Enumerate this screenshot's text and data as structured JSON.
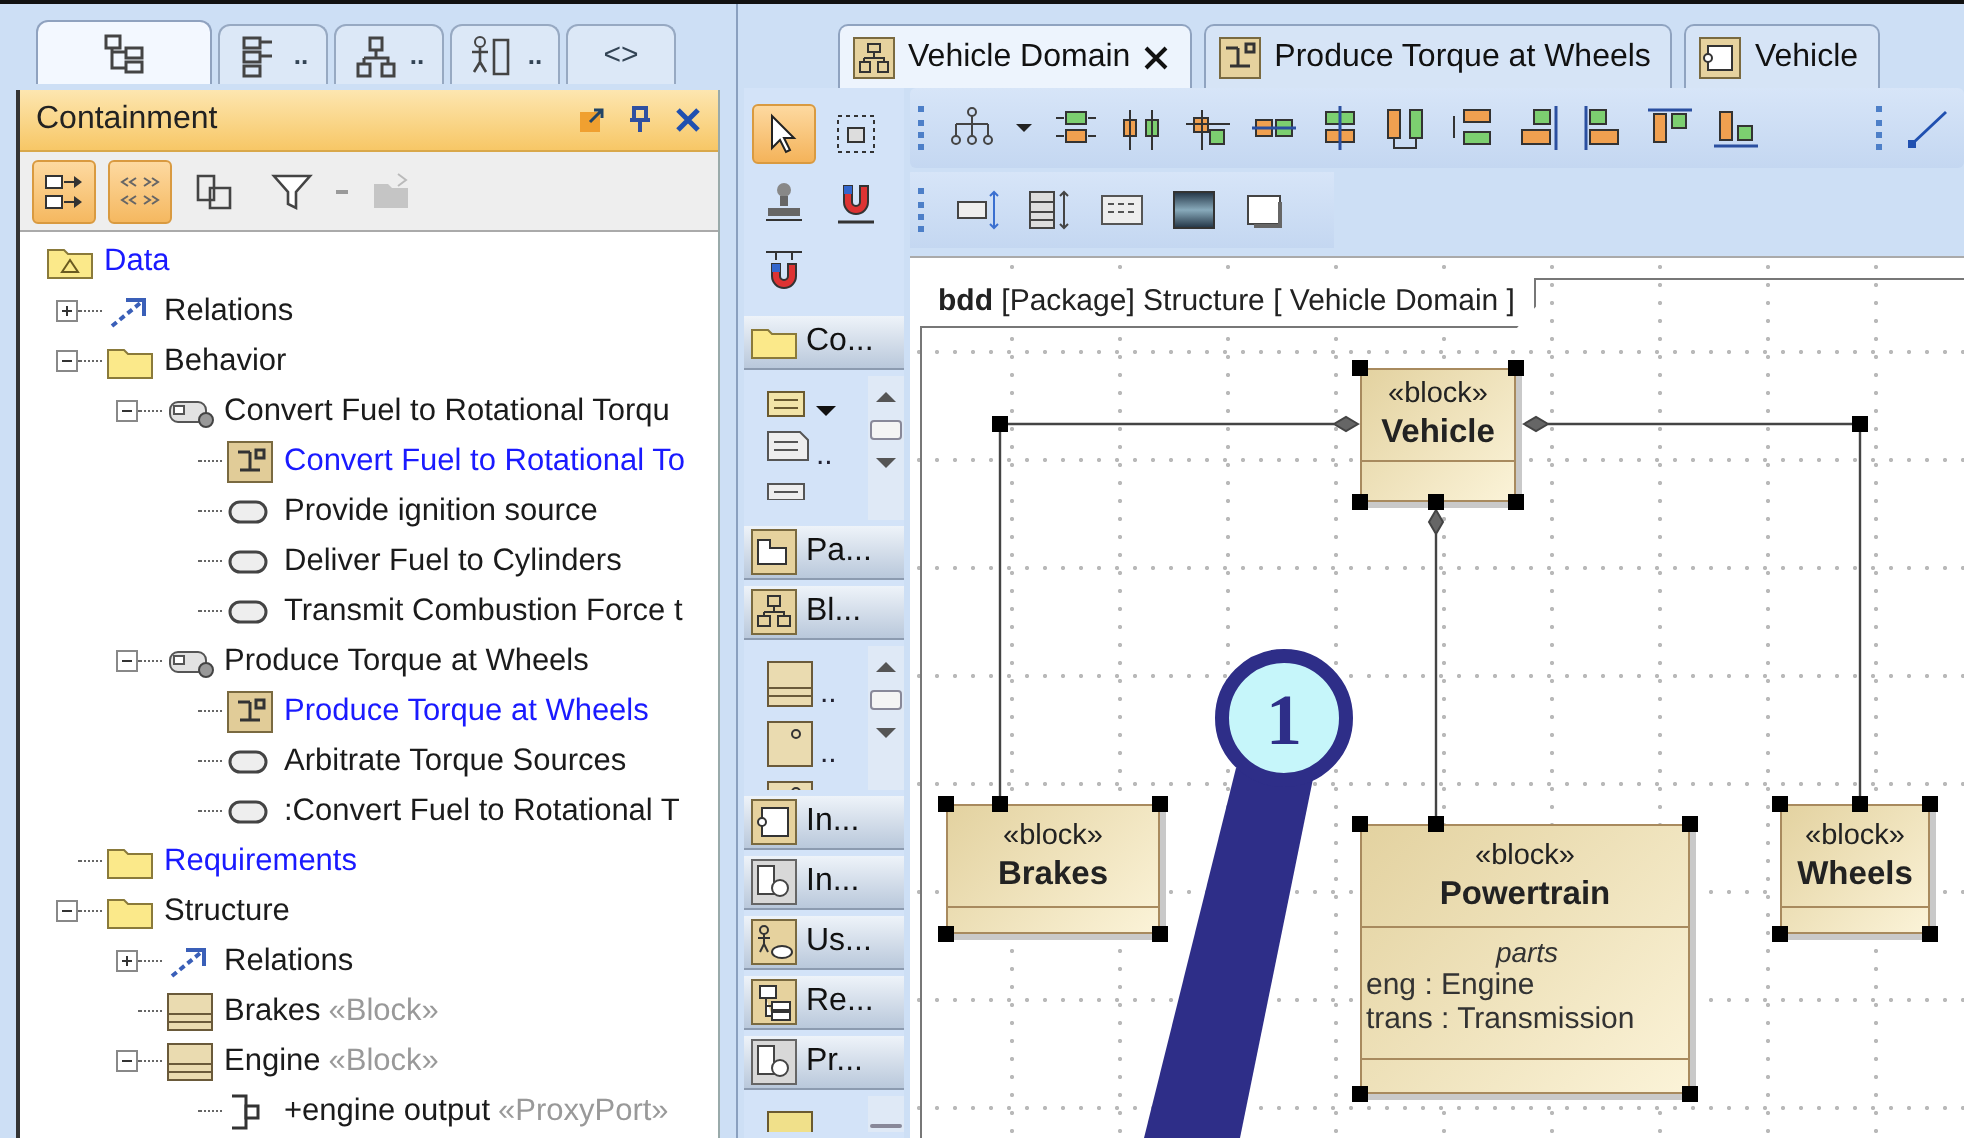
{
  "explorer": {
    "tabs": [
      {
        "selected": true
      },
      {
        "label": "..",
        "selected": false
      },
      {
        "label": "..",
        "selected": false
      },
      {
        "label": "..",
        "selected": false
      },
      {
        "label": "<>",
        "selected": false
      }
    ],
    "title": "Containment",
    "toolbar": [
      {
        "on": true,
        "disabled": false
      },
      {
        "on": true,
        "disabled": false
      },
      {
        "on": false,
        "disabled": false
      },
      {
        "on": false,
        "disabled": false
      },
      {
        "on": false,
        "disabled": true
      }
    ],
    "tree": [
      {
        "label": "Data",
        "kind": "package",
        "highlighted": true,
        "children": [
          {
            "label": "Relations",
            "kind": "relations",
            "highlighted": false,
            "expanded": false
          },
          {
            "label": "Behavior",
            "kind": "folder",
            "highlighted": false,
            "expanded": true,
            "children": [
              {
                "label": "Convert Fuel to Rotational Torqu",
                "kind": "process",
                "highlighted": false,
                "expanded": true,
                "children": [
                  {
                    "label": "Convert Fuel to Rotational To",
                    "kind": "diagram",
                    "highlighted": true
                  },
                  {
                    "label": "Provide ignition source",
                    "kind": "action",
                    "highlighted": false
                  },
                  {
                    "label": "Deliver Fuel to Cylinders",
                    "kind": "action",
                    "highlighted": false
                  },
                  {
                    "label": "Transmit Combustion Force t",
                    "kind": "action",
                    "highlighted": false
                  }
                ]
              },
              {
                "label": "Produce Torque at Wheels",
                "kind": "process",
                "highlighted": false,
                "expanded": true,
                "children": [
                  {
                    "label": "Produce Torque at Wheels",
                    "kind": "diagram",
                    "highlighted": true
                  },
                  {
                    "label": "Arbitrate Torque Sources",
                    "kind": "action",
                    "highlighted": false
                  },
                  {
                    "label": ":Convert Fuel to Rotational T",
                    "kind": "action",
                    "highlighted": false
                  }
                ]
              }
            ]
          },
          {
            "label": "Requirements",
            "kind": "folder",
            "highlighted": true
          },
          {
            "label": "Structure",
            "kind": "folder",
            "highlighted": false,
            "expanded": true,
            "children": [
              {
                "label": "Relations",
                "kind": "relations",
                "highlighted": false,
                "expanded": false
              },
              {
                "label": "Brakes",
                "kind": "block",
                "highlighted": false,
                "stereotype": "«Block»"
              },
              {
                "label": "Engine",
                "kind": "block",
                "highlighted": false,
                "stereotype": "«Block»",
                "expanded": true,
                "children": [
                  {
                    "label": "+engine output",
                    "kind": "port",
                    "highlighted": false,
                    "stereotype": "«ProxyPort»"
                  }
                ]
              }
            ]
          }
        ]
      }
    ]
  },
  "editor": {
    "tabs": [
      {
        "label": "Vehicle Domain",
        "selected": true,
        "closable": true
      },
      {
        "label": "Produce Torque at Wheels",
        "selected": false,
        "closable": false
      },
      {
        "label": "Vehicle",
        "selected": false,
        "closable": false
      }
    ],
    "palette": {
      "tools": [
        {
          "selected": true
        },
        {
          "selected": false
        },
        {
          "selected": false
        },
        {
          "selected": false
        },
        {
          "selected": false
        }
      ],
      "entries": [
        {
          "kind": "header",
          "label": "Co..."
        },
        {
          "kind": "list",
          "items": [
            {
              "menu": true
            },
            {
              "label": "..",
              "menu": false
            },
            {
              "menu": false
            }
          ]
        },
        {
          "kind": "header",
          "label": "Pa..."
        },
        {
          "kind": "header",
          "label": "Bl..."
        },
        {
          "kind": "list",
          "items": [
            {
              "label": "..",
              "menu": false
            },
            {
              "label": "..",
              "menu": false
            },
            {
              "menu": false
            }
          ]
        },
        {
          "kind": "header",
          "label": "In..."
        },
        {
          "kind": "header",
          "label": "In..."
        },
        {
          "kind": "header",
          "label": "Us..."
        },
        {
          "kind": "header",
          "label": "Re..."
        },
        {
          "kind": "header",
          "label": "Pr..."
        },
        {
          "kind": "list",
          "items": [
            {
              "menu": false
            }
          ]
        }
      ]
    },
    "diagram": {
      "frame_label": "**bdd** [Package] Structure [ Vehicle Domain ]",
      "blocks": [
        {
          "stereotype": "«block»",
          "name": "Vehicle",
          "selected": true
        },
        {
          "stereotype": "«block»",
          "name": "Brakes",
          "selected": true
        },
        {
          "stereotype": "«block»",
          "name": "Powertrain",
          "selected": true,
          "compartment": {
            "title": "parts",
            "entries": [
              "eng : Engine",
              "trans : Transmission"
            ]
          }
        },
        {
          "stereotype": "«block»",
          "name": "Wheels",
          "selected": true
        }
      ],
      "connectors": [
        {
          "selected": true
        },
        {
          "selected": true
        },
        {
          "selected": true
        }
      ],
      "callout": {
        "label": "1"
      }
    }
  }
}
